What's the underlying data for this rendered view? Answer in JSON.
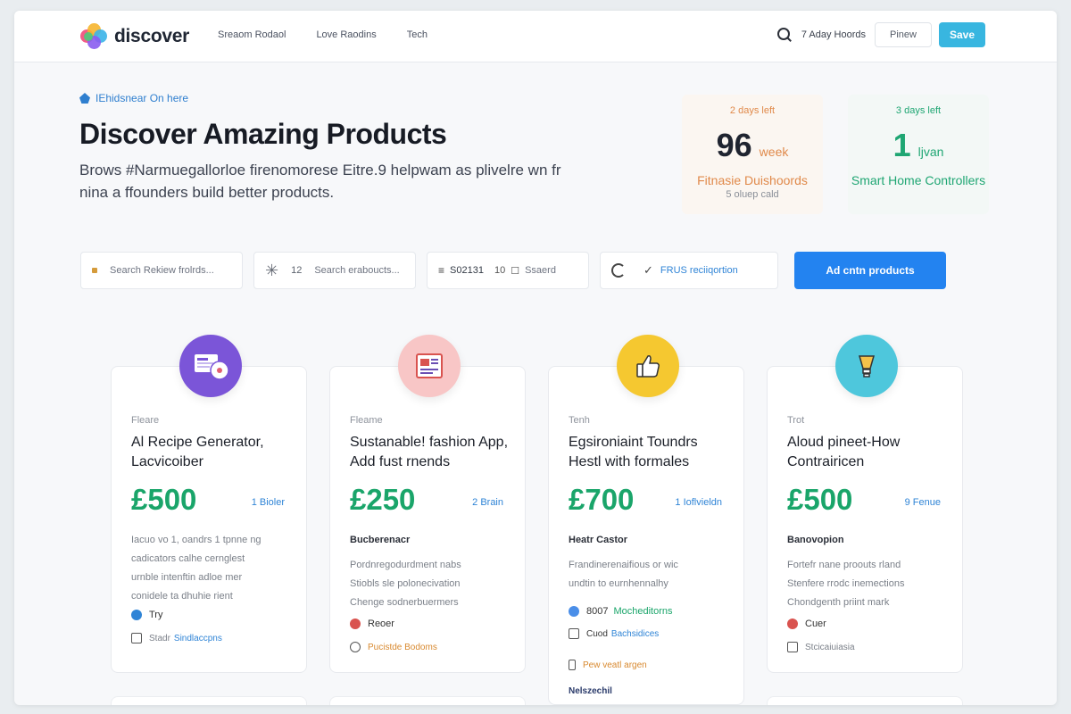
{
  "header": {
    "logo_text": "discover",
    "nav": [
      "Sreaom Rodaol",
      "Love Raodins",
      "Tech"
    ],
    "link": "7 Aday Hoords",
    "preview_button": "Pinew",
    "save_button": "Save"
  },
  "hero": {
    "eyebrow": "IEhidsnear On here",
    "title": "Discover Amazing Products",
    "subtitle": "Brows #Narmuegallorloe firenomorese Eitre.9 helpwam as plivelre wn fr nina a ffounders build better products."
  },
  "stats": [
    {
      "days": "2 days left",
      "number": "96",
      "unit": "week",
      "label": "Fitnasie Duishoords",
      "sub": "5 oluep cald"
    },
    {
      "days": "3 days left",
      "number": "1",
      "unit": "ljvan",
      "label": "Smart Home Controllers",
      "sub": ""
    }
  ],
  "filters": {
    "search_reviews": "Search Rekiew frolrds...",
    "count": "12",
    "search_products": "Search eraboucts...",
    "code": "S02131",
    "small": "10",
    "sort": "Ssaerd",
    "tag": "FRUS reciiqortion",
    "cta": "Ad cntn products"
  },
  "cards": [
    {
      "category": "Fleare",
      "title": "Al Recipe Generator, Lacvicoiber",
      "price": "£500",
      "meta": "1 Bioler",
      "subheading": "",
      "desc": [
        "Iacuo vo 1, oandrs 1 tpnne ng",
        "cadicators calhe cernglest",
        "urnble intenftin adloe mer",
        "conidele ta dhuhie rient"
      ],
      "foot1": "Try",
      "foot2_label": "Stadr",
      "foot2_link": "Sindlaccpns"
    },
    {
      "category": "Fleame",
      "title": "Sustanable! fashion App, Add fust rnends",
      "price": "£250",
      "meta": "2 Brain",
      "subheading": "Bucberenacr",
      "desc": [
        "Pordnregodurdment nabs",
        "Stiobls sle polonecivation",
        "Chenge sodnerbuermers"
      ],
      "foot1": "Reoer",
      "foot2_label": "",
      "foot2_link": "Pucistde Bodoms"
    },
    {
      "category": "Tenh",
      "title": "Egsironiaint Toundrs Hestl with formales",
      "price": "£700",
      "meta": "1 Ioflvieldn",
      "subheading": "Heatr Castor",
      "desc": [
        "Frandinerenaifious or wic",
        "undtin to eurnhennalhy"
      ],
      "foot1": "8007",
      "foot1_extra": "Mocheditorns",
      "foot2_label": "Cuod",
      "foot2_link": "Bachsidices",
      "foot3": "Pew veatl argen",
      "foot4": "Nelszechil"
    },
    {
      "category": "Trot",
      "title": "Aloud pineet-How Contrairicen",
      "price": "£500",
      "meta": "9 Fenue",
      "subheading": "Banovopion",
      "desc": [
        "Fortefr nane proouts rland",
        "Stenfere rrodc inemections",
        "Chondgenth priint mark"
      ],
      "foot1": "Cuer",
      "foot2_label": "Stcicaiuiasia",
      "foot2_link": ""
    }
  ],
  "colors": {
    "accent": "#2383f0",
    "price_green": "#1aa56a",
    "save_blue": "#38b6e0",
    "stat_orange": "#e0894a"
  }
}
